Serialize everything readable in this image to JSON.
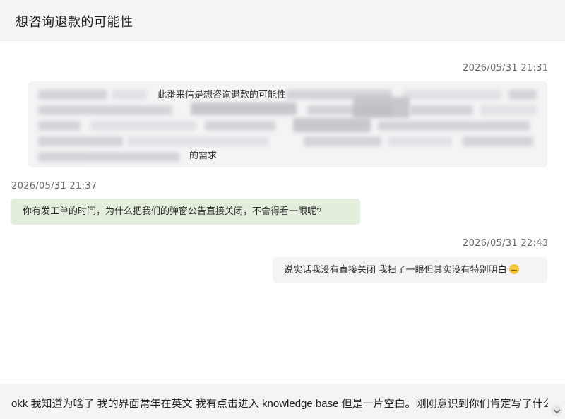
{
  "header": {
    "title": "想咨询退款的可能性"
  },
  "messages": [
    {
      "timestamp": "2026/05/31 21:31",
      "side": "right",
      "visible_fragments": [
        "此番来信是想咨询退款的可能性",
        "的需求"
      ]
    },
    {
      "timestamp": "2026/05/31 21:37",
      "side": "left",
      "text": "你有发工单的时间，为什么把我们的弹窗公告直接关闭，不舍得看一眼呢?"
    },
    {
      "timestamp": "2026/05/31 22:43",
      "side": "right",
      "text": "说实话我没有直接关闭 我扫了一眼但其实没有特别明白"
    }
  ],
  "composer": {
    "text": "okk 我知道为啥了 我的界面常年在英文 我有点击进入 knowledge base 但是一片空白。刚刚意识到你们肯定写了什么"
  },
  "colors": {
    "header_bg": "#f4f4f5",
    "agent_bubble": "#e3efdc",
    "user_bubble": "#f4f4f6"
  }
}
